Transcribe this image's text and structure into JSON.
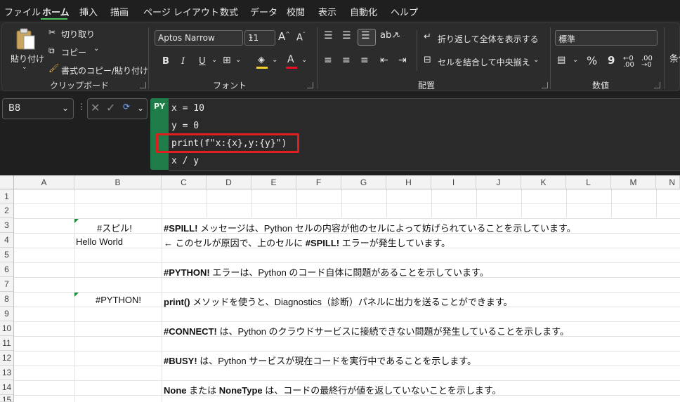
{
  "menu": [
    "ファイル",
    "ホーム",
    "挿入",
    "描画",
    "ページ レイアウト",
    "数式",
    "データ",
    "校閲",
    "表示",
    "自動化",
    "ヘルプ"
  ],
  "menu_active_index": 1,
  "ribbon": {
    "clipboard": {
      "paste": "貼り付け",
      "cut": "切り取り",
      "copy": "コピー",
      "format_painter": "書式のコピー/貼り付け",
      "label": "クリップボード"
    },
    "font": {
      "name": "Aptos Narrow",
      "size": "11",
      "grow": "A",
      "shrink": "A",
      "bold": "B",
      "italic": "I",
      "underline": "U",
      "font_color": "A",
      "label": "フォント"
    },
    "alignment": {
      "wrap": "折り返して全体を表示する",
      "merge": "セルを結合して中央揃え",
      "label": "配置"
    },
    "number": {
      "format": "標準",
      "percent": "%",
      "comma": "9",
      "label": "数値"
    },
    "conditional": "条件"
  },
  "formula_bar": {
    "namebox": "B8",
    "py_badge": "PY",
    "code": [
      "x = 10",
      "y = 0",
      "print(f\"x:{x},y:{y}\")",
      "x / y"
    ]
  },
  "columns": [
    "A",
    "B",
    "C",
    "D",
    "E",
    "F",
    "G",
    "H",
    "I",
    "J",
    "K",
    "L",
    "M",
    "N"
  ],
  "rows": [
    "1",
    "2",
    "3",
    "4",
    "5",
    "6",
    "7",
    "8",
    "9",
    "10",
    "11",
    "12",
    "13",
    "14",
    "15"
  ],
  "cells": {
    "b3": "#スピル!",
    "b4": "Hello World",
    "b8": "#PYTHON!",
    "c3_bold": "#SPILL!",
    "c3_rest": " メッセージは、Python セルの内容が他のセルによって妨げられていることを示しています。",
    "c4_pre": "← このセルが原因で、上のセルに ",
    "c4_bold": "#SPILL!",
    "c4_rest": " エラーが発生しています。",
    "c6_bold": "#PYTHON!",
    "c6_rest": " エラーは、Python のコード自体に問題があることを示しています。",
    "c8_bold": "print()",
    "c8_rest": " メソッドを使うと、Diagnostics（診断）パネルに出力を送ることができます。",
    "c10_bold": "#CONNECT!",
    "c10_rest": " は、Python のクラウドサービスに接続できない問題が発生していることを示します。",
    "c12_bold": "#BUSY!",
    "c12_rest": " は、Python サービスが現在コードを実行中であることを示します。",
    "c14_bold1": "None",
    "c14_mid": " または ",
    "c14_bold2": "NoneType",
    "c14_rest": " は、コードの最終行が値を返していないことを示します。"
  },
  "colors": {
    "accent_green": "#1f7d4a",
    "highlight_red": "#e01e1e",
    "font_color_red": "#e81123"
  }
}
